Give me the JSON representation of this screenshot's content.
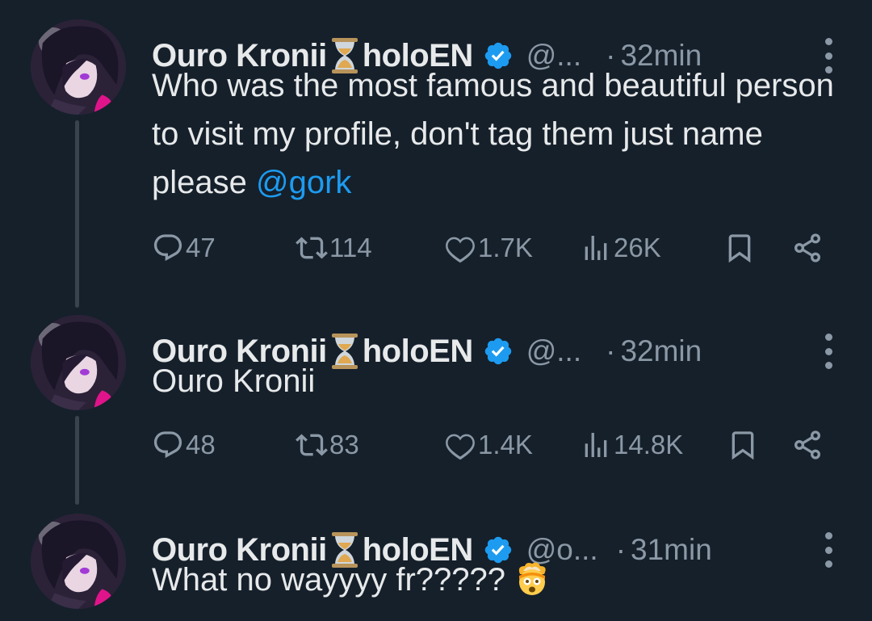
{
  "colors": {
    "background": "#15202b",
    "text": "#e7e9ea",
    "muted": "#8b98a5",
    "accent": "#1d9bf0",
    "thread_line": "#38444d"
  },
  "tweets": [
    {
      "name_left": "Ouro Kronii",
      "name_right": "holoEN",
      "handle": "@...",
      "dot": "·",
      "time": "32min",
      "text": "Who was the most famous and beautiful person to visit my profile, don't tag them just name please ",
      "mention": "@gork",
      "emoji": "",
      "stats": {
        "replies": "47",
        "reposts": "114",
        "likes": "1.7K",
        "views": "26K"
      }
    },
    {
      "name_left": "Ouro Kronii",
      "name_right": "holoEN",
      "handle": "@...",
      "dot": "·",
      "time": "32min",
      "text": "Ouro Kronii",
      "mention": "",
      "emoji": "",
      "stats": {
        "replies": "48",
        "reposts": "83",
        "likes": "1.4K",
        "views": "14.8K"
      }
    },
    {
      "name_left": "Ouro Kronii",
      "name_right": "holoEN",
      "handle": "@o...",
      "dot": "·",
      "time": "31min",
      "text": "What no wayyyy fr?????",
      "mention": "",
      "emoji": "exploding-head-emoji"
    }
  ],
  "icons": {
    "reply": "reply-icon",
    "repost": "repost-icon",
    "like": "heart-icon",
    "views": "views-icon",
    "bookmark": "bookmark-icon",
    "share": "share-icon",
    "more": "more-icon",
    "verified": "verified-badge-icon",
    "hourglass": "hourglass-icon"
  }
}
